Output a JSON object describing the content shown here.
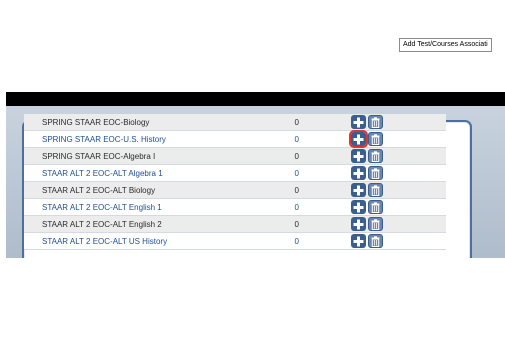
{
  "table": {
    "rows": [
      {
        "name": "SPRING STAAR EOC-Biology",
        "count": "0"
      },
      {
        "name": "SPRING STAAR EOC-U.S. History",
        "count": "0"
      },
      {
        "name": "SPRING STAAR EOC-Algebra I",
        "count": "0"
      },
      {
        "name": "STAAR ALT 2 EOC-ALT Algebra 1",
        "count": "0"
      },
      {
        "name": "STAAR ALT 2 EOC-ALT Biology",
        "count": "0"
      },
      {
        "name": "STAAR ALT 2 EOC-ALT English 1",
        "count": "0"
      },
      {
        "name": "STAAR ALT 2 EOC-ALT English 2",
        "count": "0"
      },
      {
        "name": "STAAR ALT 2 EOC-ALT US History",
        "count": "0"
      }
    ]
  },
  "tooltip": {
    "text": "Add Test/Courses Associati"
  },
  "icons": {
    "add": "plus-icon",
    "delete": "trash-icon"
  },
  "colors": {
    "button": "#3a5f8f",
    "frame": "#4e6e9c",
    "focus": "#e03434"
  }
}
